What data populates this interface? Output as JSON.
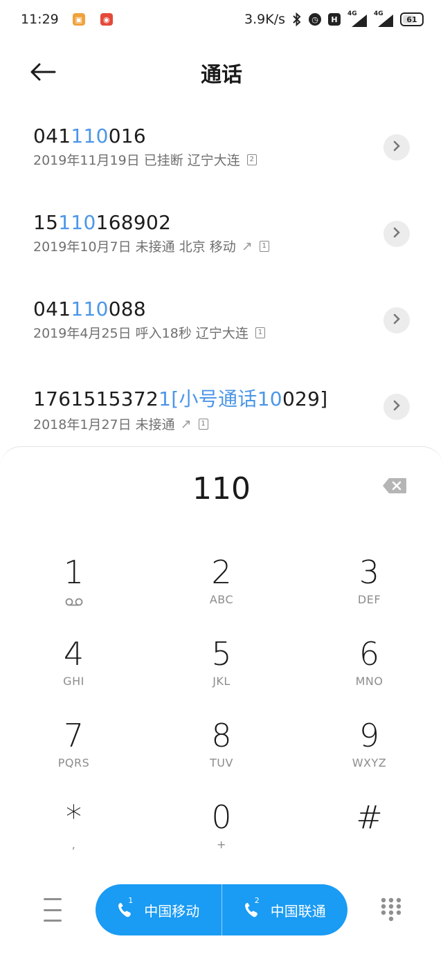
{
  "status_bar": {
    "time": "11:29",
    "net_speed": "3.9K/s",
    "net_type_1": "4G",
    "net_type_2": "4G",
    "battery": "61",
    "hd_label": "H"
  },
  "header": {
    "title": "通话"
  },
  "results": [
    {
      "pre": "041",
      "match": "110",
      "post": "016",
      "meta": "2019年11月19日 已挂断 辽宁大连",
      "outgoing": false,
      "sim": "2"
    },
    {
      "pre": "15",
      "match": "110",
      "post": "168902",
      "meta": "2019年10月7日 未接通 北京 移动",
      "outgoing": true,
      "sim": "1"
    },
    {
      "pre": "041",
      "match": "110",
      "post": "088",
      "meta": "2019年4月25日 呼入18秒 辽宁大连",
      "outgoing": false,
      "sim": "1"
    },
    {
      "pre": "1761515372",
      "match": "1[小号通话10",
      "post": "029]",
      "meta": "2018年1月27日 未接通",
      "outgoing": true,
      "sim": "1"
    }
  ],
  "dialpad": {
    "input": "110",
    "keys": [
      {
        "digit": "1",
        "sub": ""
      },
      {
        "digit": "2",
        "sub": "ABC"
      },
      {
        "digit": "3",
        "sub": "DEF"
      },
      {
        "digit": "4",
        "sub": "GHI"
      },
      {
        "digit": "5",
        "sub": "JKL"
      },
      {
        "digit": "6",
        "sub": "MNO"
      },
      {
        "digit": "7",
        "sub": "PQRS"
      },
      {
        "digit": "8",
        "sub": "TUV"
      },
      {
        "digit": "9",
        "sub": "WXYZ"
      },
      {
        "digit": "*",
        "sub": ","
      },
      {
        "digit": "0",
        "sub": "+"
      },
      {
        "digit": "#",
        "sub": ""
      }
    ]
  },
  "call_buttons": {
    "sim1_label": "中国移动",
    "sim1_num": "1",
    "sim2_label": "中国联通",
    "sim2_num": "2"
  },
  "colors": {
    "accent": "#1a9bf4",
    "highlight": "#4b96e8"
  }
}
